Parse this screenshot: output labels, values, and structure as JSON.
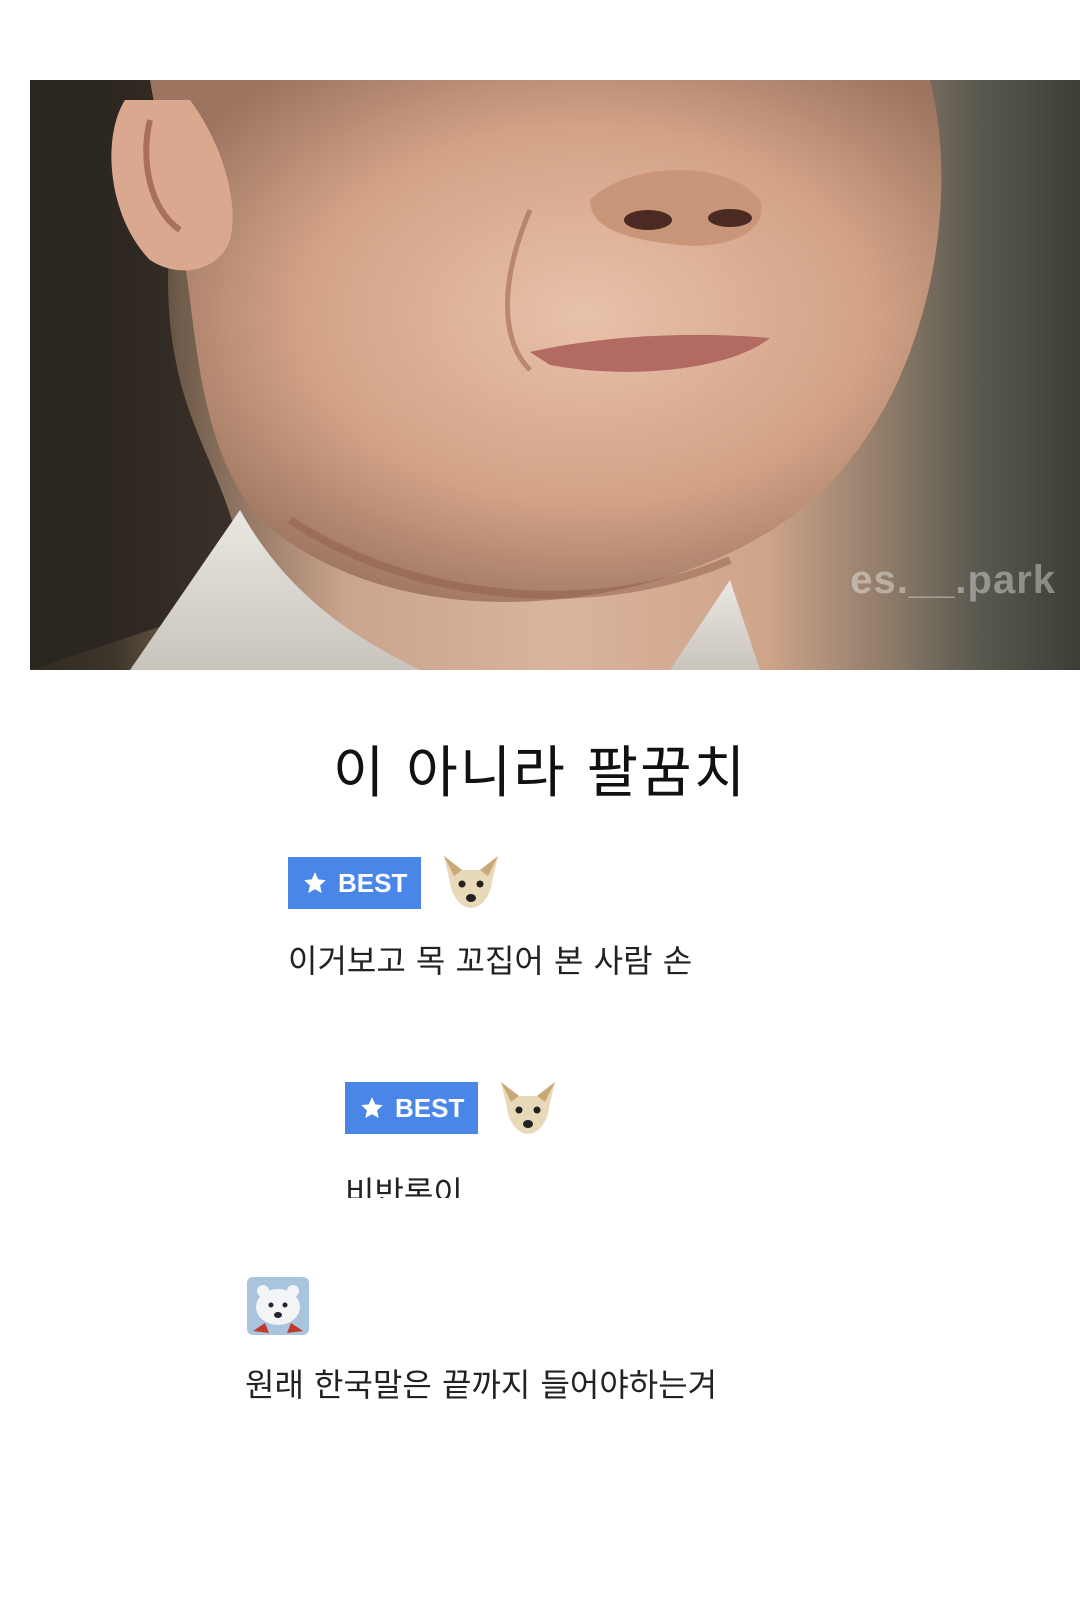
{
  "photo": {
    "watermark": "es.__.park"
  },
  "caption": "이 아니라 팔꿈치",
  "comments": [
    {
      "badge": "BEST",
      "badge_icon": "star-icon",
      "avatar_icon": "chihuahua-icon",
      "text": "이거보고 목 꼬집어 본 사람 손"
    },
    {
      "badge": "BEST",
      "badge_icon": "star-icon",
      "avatar_icon": "chihuahua-icon",
      "text": "비반론이"
    },
    {
      "avatar_icon": "polar-bear-icon",
      "text": "원래 한국말은 끝까지 들어야하는겨"
    }
  ],
  "colors": {
    "badge_blue": "#4a86e8",
    "text": "#222222"
  }
}
